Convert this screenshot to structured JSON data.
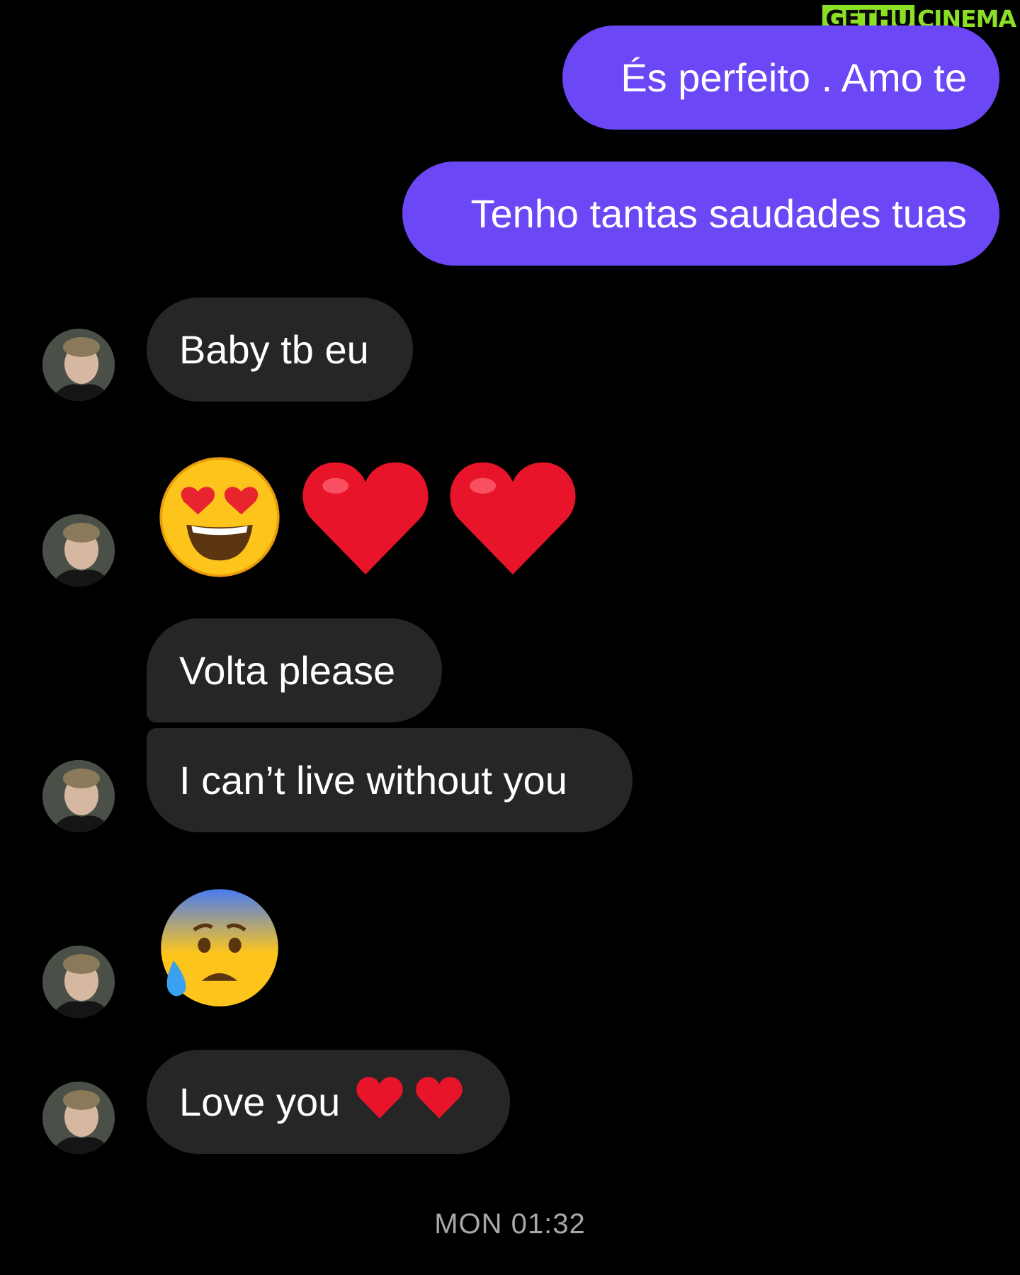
{
  "watermark": {
    "part1": "GETHU",
    "part2": "CINEMA"
  },
  "messages": {
    "sent_1": "És perfeito . Amo te",
    "sent_2": "Tenho tantas saudades tuas",
    "recv_1": "Baby tb eu",
    "recv_2_emojis": [
      "smiling-face-with-heart-eyes",
      "red-heart",
      "red-heart"
    ],
    "recv_3": "Volta please",
    "recv_4": "I can’t live without you",
    "recv_5_emojis": [
      "anxious-face-with-sweat"
    ],
    "recv_6": "Love you",
    "recv_6_emojis": [
      "red-heart",
      "red-heart"
    ]
  },
  "timestamp": "MON 01:32",
  "colors": {
    "background": "#000000",
    "sent_bubble": "#6b47f5",
    "received_bubble": "#262626",
    "timestamp_text": "#a8a8a8",
    "watermark": "#8be025"
  }
}
